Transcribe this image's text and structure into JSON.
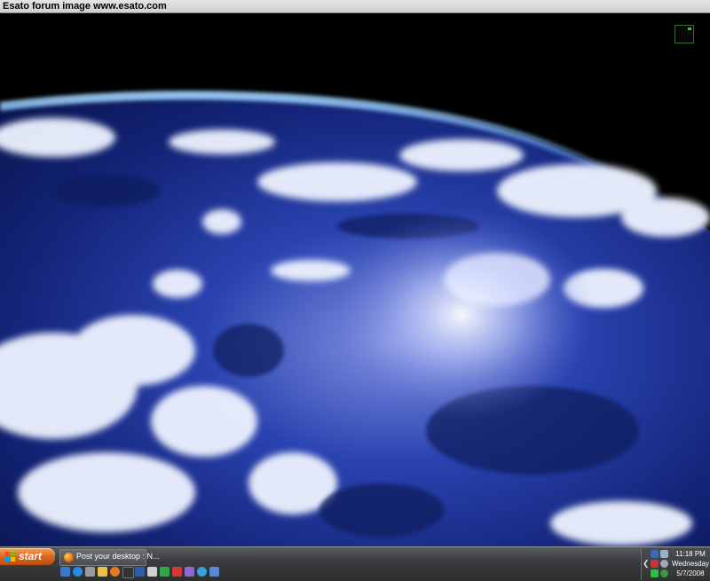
{
  "banner": {
    "text": "Esato forum image www.esato.com"
  },
  "taskbar": {
    "start_label": "start",
    "task_window_title": "Post your desktop : N...",
    "quick_launch_icons": [
      "show-desktop-icon",
      "ie-icon",
      "onenote-icon",
      "folder-icon",
      "firefox-icon",
      "media-icon",
      "app-icon",
      "notepad-icon",
      "green-app-icon",
      "mail-icon",
      "app2-icon",
      "search-icon",
      "misc-icon"
    ]
  },
  "tray": {
    "time": "11:18 PM",
    "weekday": "Wednesday",
    "date": "5/7/2008",
    "icons": [
      "network-icon",
      "volume-icon",
      "security-icon",
      "shield-icon",
      "green-status-icon",
      "check-icon"
    ]
  },
  "colors": {
    "taskbar": "#3a3c3e",
    "start_button": "#d8621b",
    "ocean": "#1a2f8a",
    "space": "#000000"
  }
}
